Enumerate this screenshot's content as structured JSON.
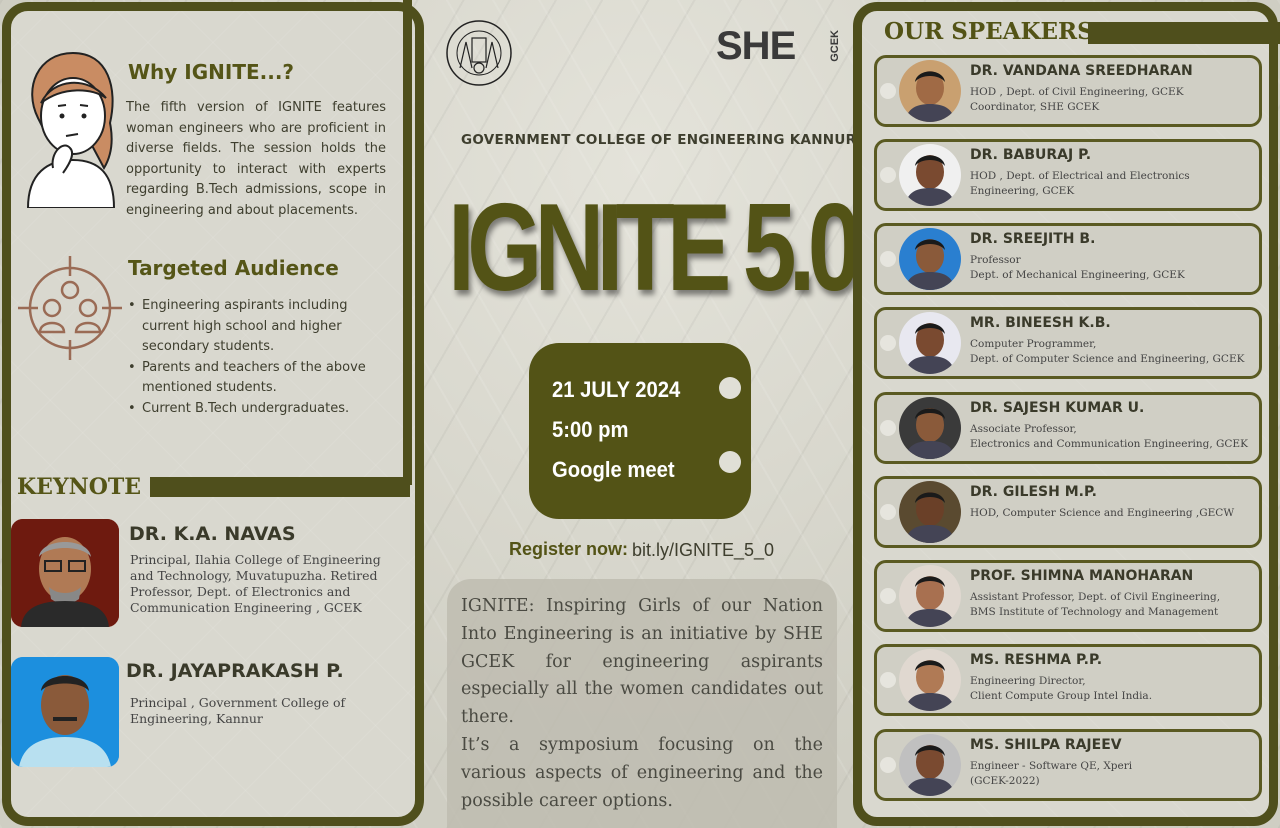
{
  "left": {
    "why_title": "Why IGNITE...?",
    "why_text": "The fifth version of IGNITE features woman engineers who are proficient in diverse fields. The session holds the opportunity to interact with experts regarding B.Tech admissions, scope in engineering and about placements.",
    "target_title": "Targeted Audience",
    "audience": [
      "Engineering aspirants including current high school and higher secondary students.",
      "Parents and teachers of the above mentioned students.",
      "Current B.Tech undergraduates."
    ],
    "keynote_title": "KEYNOTE",
    "keynotes": [
      {
        "name": "DR. K.A. NAVAS",
        "desc": "Principal, Ilahia College of Engineering and Technology, Muvatupuzha. Retired Professor, Dept. of Electronics and Communication Engineering , GCEK"
      },
      {
        "name": "DR. JAYAPRAKASH P.",
        "desc": "Principal , Government College of Engineering, Kannur"
      }
    ]
  },
  "center": {
    "she_logo": "SHE",
    "she_sub": "GCEK",
    "college_name": "GOVERNMENT COLLEGE OF ENGINEERING KANNUR",
    "event_title": "IGNITE 5.0",
    "date": "21 JULY 2024",
    "time": "5:00 pm",
    "venue": "Google meet",
    "register_label": "Register now:",
    "register_link": "bit.ly/IGNITE_5_0",
    "about": "IGNITE: Inspiring Girls of our Nation Into Engineering is an initiative by SHE GCEK for engineering aspirants especially all the women candidates out there.",
    "about2": "It’s a symposium focusing on the various aspects of engineering and the possible career options."
  },
  "right": {
    "title": "OUR SPEAKERS",
    "speakers": [
      {
        "name": "DR. VANDANA SREEDHARAN",
        "desc": "HOD , Dept. of Civil Engineering, GCEK",
        "desc2": "Coordinator, SHE GCEK"
      },
      {
        "name": "DR. BABURAJ P.",
        "desc": "HOD , Dept. of Electrical and Electronics Engineering, GCEK",
        "desc2": ""
      },
      {
        "name": "DR. SREEJITH B.",
        "desc": "Professor",
        "desc2": "Dept. of Mechanical Engineering, GCEK"
      },
      {
        "name": "MR. BINEESH K.B.",
        "desc": "Computer Programmer,",
        "desc2": "Dept. of Computer Science and Engineering, GCEK"
      },
      {
        "name": "DR. SAJESH KUMAR U.",
        "desc": "Associate Professor,",
        "desc2": "Electronics and Communication Engineering, GCEK"
      },
      {
        "name": "DR. GILESH M.P.",
        "desc": "HOD, Computer Science and Engineering ,GECW",
        "desc2": ""
      },
      {
        "name": "PROF. SHIMNA MANOHARAN",
        "desc": "Assistant Professor, Dept. of Civil Engineering,",
        "desc2": "BMS Institute of Technology and Management"
      },
      {
        "name": "MS. RESHMA P.P.",
        "desc": "Engineering Director,",
        "desc2": "Client Compute Group Intel India."
      },
      {
        "name": "MS. SHILPA RAJEEV",
        "desc": "Engineer - Software QE, Xperi",
        "desc2": "(GCEK-2022)"
      }
    ]
  }
}
